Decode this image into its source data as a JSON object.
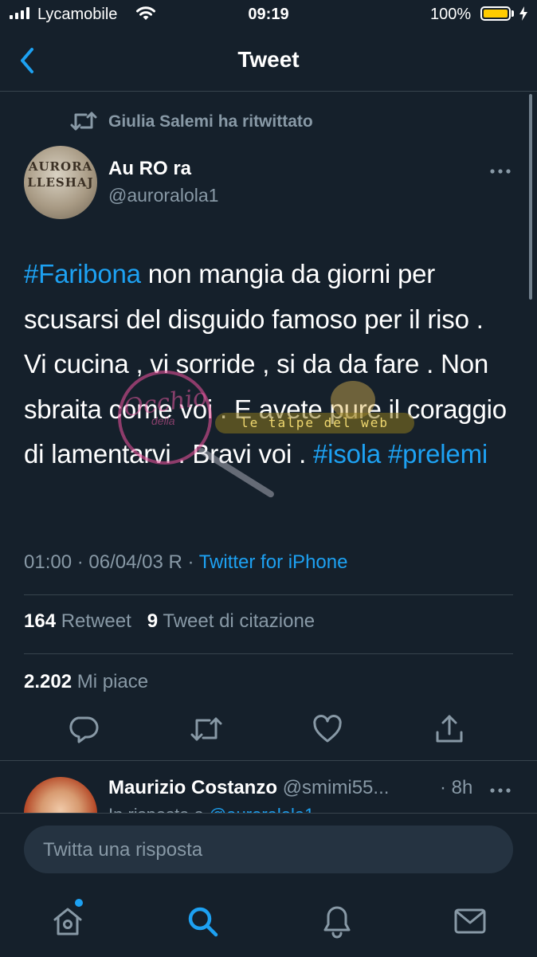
{
  "status_bar": {
    "carrier": "Lycamobile",
    "time": "09:19",
    "battery_percent": "100%",
    "battery_color": "#ffcc00",
    "icons": [
      "signal-icon",
      "wifi-icon",
      "battery-icon",
      "charging-bolt-icon"
    ]
  },
  "nav": {
    "title": "Tweet",
    "back_icon": "chevron-left-icon"
  },
  "tweet": {
    "retweet_context": "Giulia Salemi ha ritwittato",
    "author": {
      "name": "Au RO ra",
      "handle": "@auroralola1",
      "avatar_text_line1": "AURORA",
      "avatar_text_line2": "LLESHAJ"
    },
    "text": {
      "hashtag1": "#Faribona",
      "body": " non mangia da giorni per scusarsi del disguido famoso per il riso . Vi cucina , vi sorride , si da da fare . Non sbraita come voi . E avete pure il coraggio di lamentarvi . Bravi voi . ",
      "hashtag2": "#isola",
      "space": " ",
      "hashtag3": "#prelemi"
    },
    "timestamp": "01:00 · 06/04/03 R ·",
    "source": "Twitter for iPhone",
    "retweets_count": "164",
    "retweets_label": "Retweet",
    "quotes_count": "9",
    "quotes_label": "Tweet di citazione",
    "likes_count": "2.202",
    "likes_label": "Mi piace"
  },
  "watermark": {
    "script": "Occhio",
    "small": "della",
    "banner": "le talpe del web"
  },
  "actions": [
    "reply-icon",
    "retweet-icon",
    "like-icon",
    "share-icon"
  ],
  "reply_preview": {
    "name": "Maurizio Costanzo",
    "handle": "@smimi55...",
    "time": "· 8h",
    "in_reply_prefix": "In risposta a",
    "in_reply_handle": "@auroralola1"
  },
  "composer": {
    "placeholder": "Twitta una risposta"
  },
  "tab_bar": [
    "home-icon",
    "search-icon",
    "notifications-icon",
    "messages-icon"
  ],
  "colors": {
    "background": "#15202b",
    "accent": "#1da1f2",
    "secondary_text": "#8899a6",
    "divider": "#38444d"
  }
}
